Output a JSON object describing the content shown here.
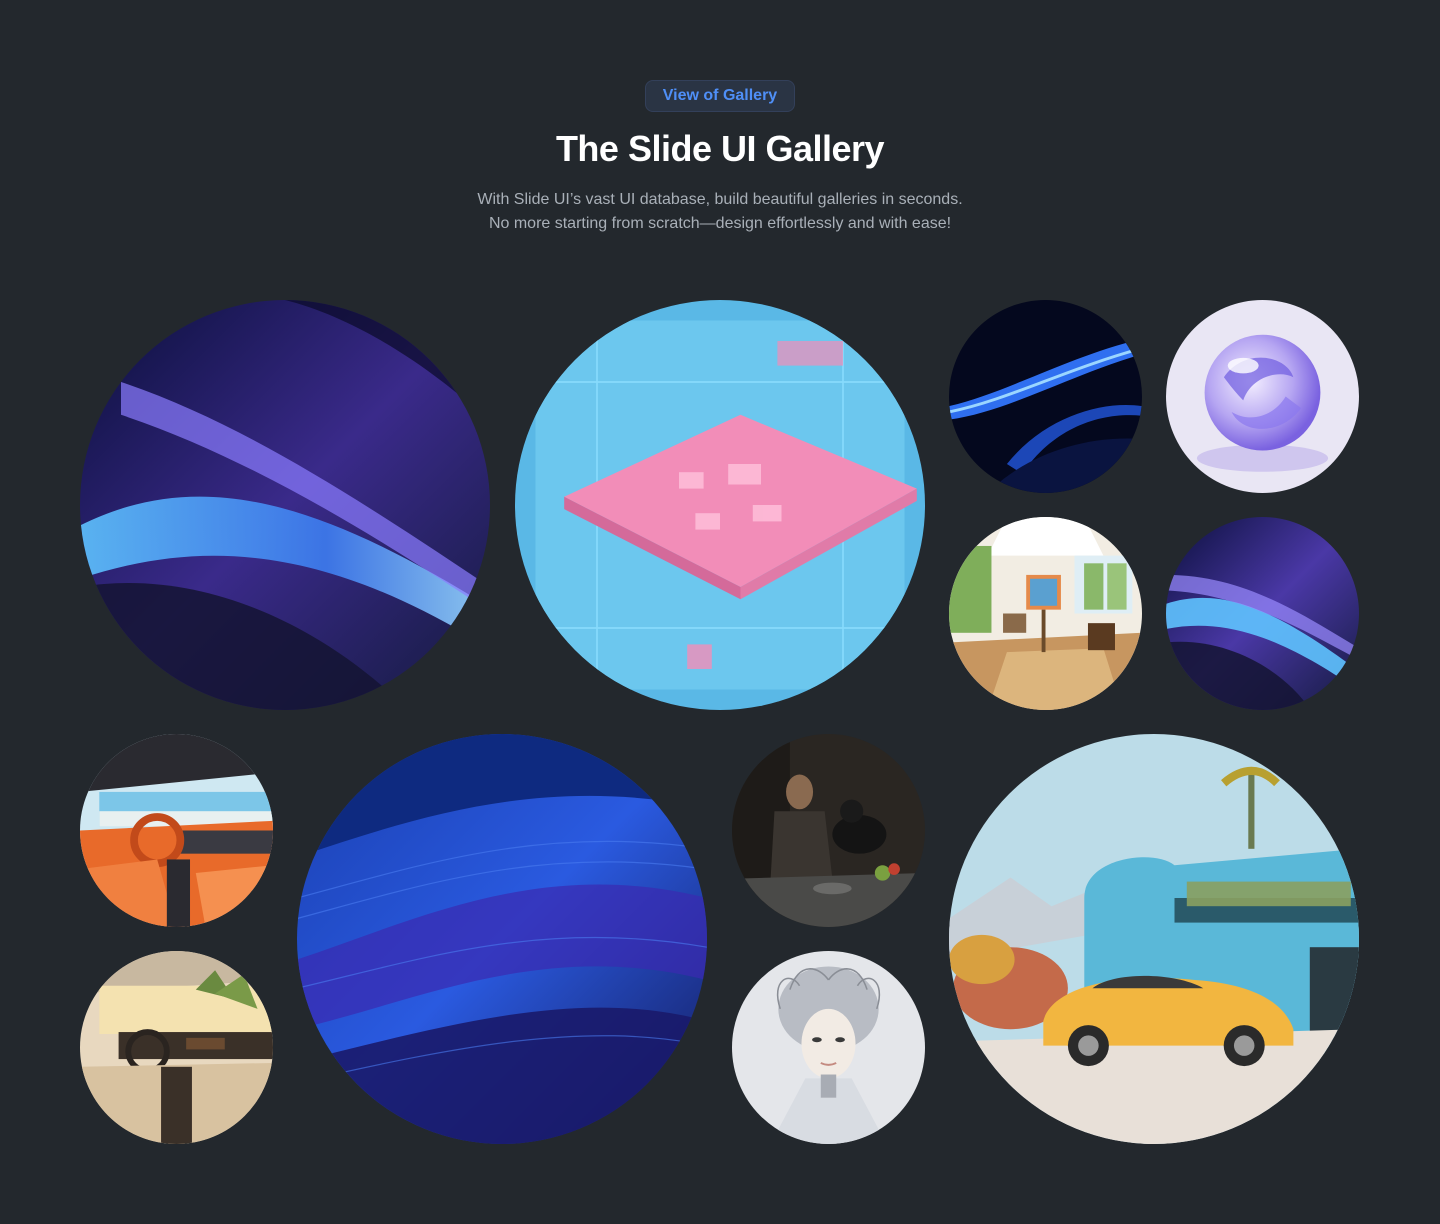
{
  "header": {
    "badge_label": "View of Gallery",
    "title": "The Slide UI Gallery",
    "subtitle_line1": "With Slide UI’s vast UI database, build beautiful galleries in seconds.",
    "subtitle_line2": "No more starting from scratch—design effortlessly and with ease!"
  },
  "colors": {
    "background": "#23282d",
    "accent": "#4f8ff7",
    "title": "#ffffff",
    "subtitle": "#a9b0b8"
  },
  "gallery": {
    "items": [
      {
        "subject": "abstract-blue-purple-waves"
      },
      {
        "subject": "pink-blue-microchip"
      },
      {
        "subject": "blue-light-streaks"
      },
      {
        "subject": "glass-sphere"
      },
      {
        "subject": "sunlit-art-studio"
      },
      {
        "subject": "abstract-blue-purple-waves"
      },
      {
        "subject": "orange-car-interior"
      },
      {
        "subject": "blue-sand-dunes"
      },
      {
        "subject": "man-with-dog-painting"
      },
      {
        "subject": "beige-car-interior"
      },
      {
        "subject": "white-android-woman"
      },
      {
        "subject": "yellow-sports-car-blue-house"
      }
    ]
  }
}
